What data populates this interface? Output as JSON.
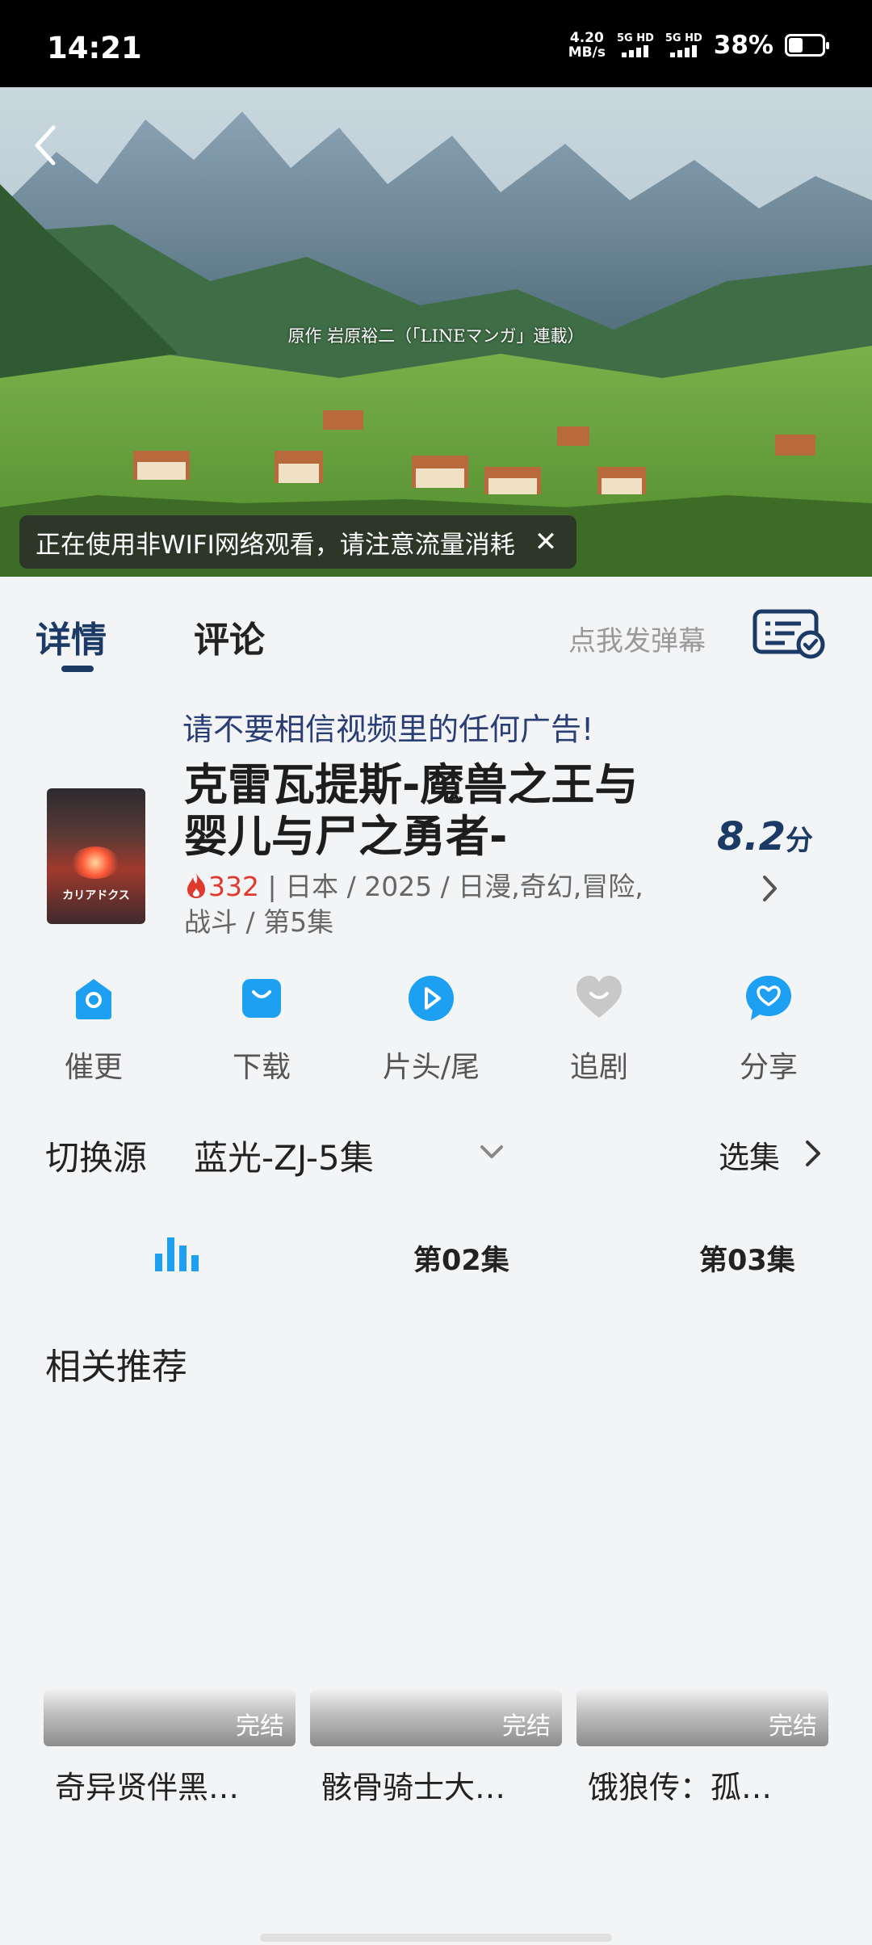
{
  "status_bar": {
    "time": "14:21",
    "net_speed_value": "4.20",
    "net_speed_unit": "MB/s",
    "sim1_label": "5G HD",
    "sim2_label": "5G HD",
    "battery_percent": "38%",
    "battery_level": 0.38
  },
  "video": {
    "credit": "原作  岩原裕二（「LINEマンガ」連載）",
    "back_icon": "chevron-left-icon",
    "network_toast": "正在使用非WIFI网络观看，请注意流量消耗",
    "toast_close": "✕"
  },
  "tabs": {
    "details": "详情",
    "comments": "评论",
    "danmaku": "点我发弹幕",
    "danmaku_icon": "danmaku-settings-icon"
  },
  "notice": "请不要相信视频里的任何广告!",
  "show": {
    "title": "克雷瓦提斯-魔兽之王与婴儿与尸之勇者-",
    "poster_text": "カリアドクス",
    "rating_value": "8.2",
    "rating_unit": "分",
    "heat": "332",
    "meta": " | 日本 / 2025 / 日漫,奇幻,冒险,战斗 / 第5集"
  },
  "actions": [
    {
      "label": "催更",
      "icon": "remind-icon",
      "color": "#1ea0f2"
    },
    {
      "label": "下载",
      "icon": "download-bag-icon",
      "color": "#1ea0f2"
    },
    {
      "label": "片头/尾",
      "icon": "skip-play-icon",
      "color": "#1ea0f2"
    },
    {
      "label": "追剧",
      "icon": "heart-follow-icon",
      "color": "#c8c8c8"
    },
    {
      "label": "分享",
      "icon": "share-heart-icon",
      "color": "#1ea0f2"
    }
  ],
  "source": {
    "label": "切换源",
    "value": "蓝光-ZJ-5集",
    "select_episode": "选集"
  },
  "episodes": [
    {
      "label": "playing",
      "icon": "equalizer-playing-icon"
    },
    {
      "label": "第02集"
    },
    {
      "label": "第03集"
    }
  ],
  "related": {
    "title": "相关推荐",
    "items": [
      {
        "title": "奇异贤伴黑…",
        "badge": "完结"
      },
      {
        "title": "骸骨骑士大…",
        "badge": "完结"
      },
      {
        "title": "饿狼传：孤…",
        "badge": "完结"
      }
    ]
  },
  "colors": {
    "accent_dark": "#1c3a66",
    "icon_blue": "#1ea0f2",
    "heat_red": "#e03a2f",
    "background": "#f3f4f6"
  }
}
